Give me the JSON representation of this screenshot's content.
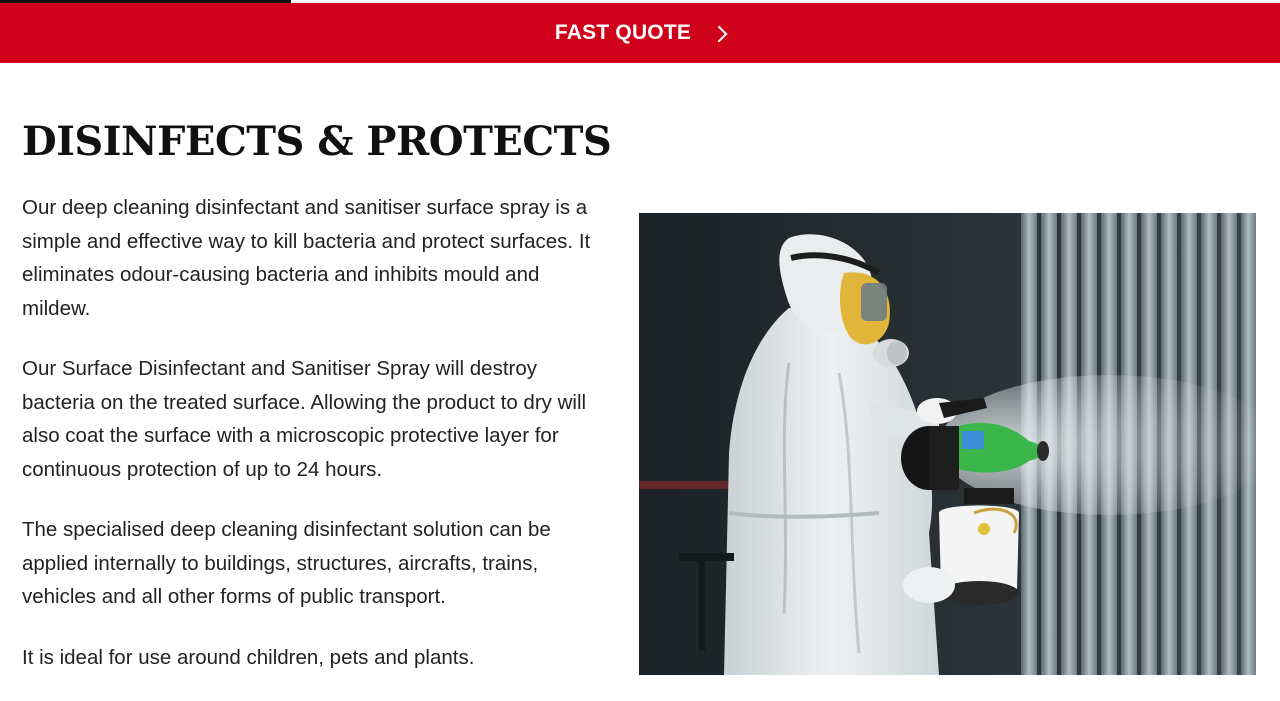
{
  "scroll_progress": {
    "fraction": 0.227
  },
  "quote_bar": {
    "label": "FAST QUOTE",
    "icon": "chevron-right-icon",
    "color": "#d0021b"
  },
  "section": {
    "heading": "DISINFECTS & PROTECTS",
    "paragraphs": [
      "Our deep cleaning disinfectant and sanitiser surface spray is a simple and effective way to kill bacteria and protect surfaces. It eliminates odour-causing bacteria and inhibits mould and mildew.",
      "Our Surface Disinfectant and Sanitiser Spray will destroy bacteria on the treated surface. Allowing the product to dry will also coat the surface with a microscopic protective layer for continuous protection of up to 24 hours.",
      "The specialised deep cleaning disinfectant solution can be applied internally to buildings, structures, aircrafts, trains, vehicles and all other forms of public transport.",
      "It is ideal for use around children, pets and plants."
    ]
  }
}
